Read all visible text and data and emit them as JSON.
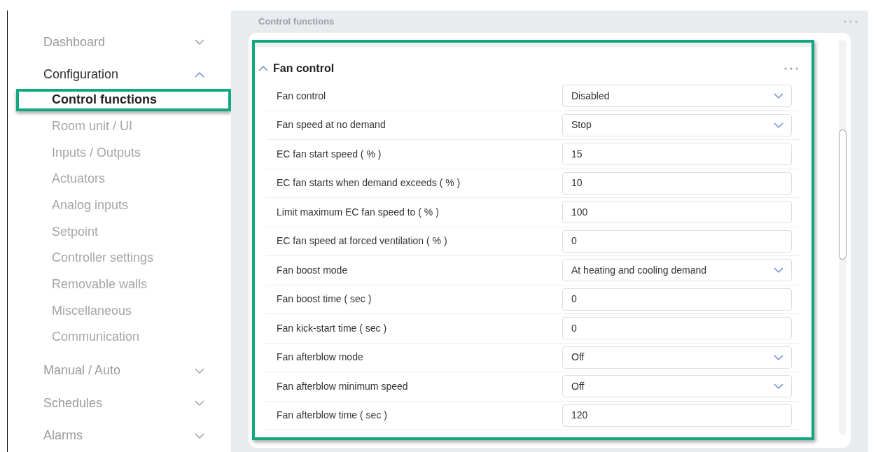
{
  "sidebar": {
    "items": [
      {
        "label": "Dashboard",
        "expanded": false
      },
      {
        "label": "Configuration",
        "expanded": true,
        "children": [
          {
            "label": "Control functions",
            "selected": true,
            "highlighted": true
          },
          {
            "label": "Room unit / UI",
            "selected": false,
            "highlighted": false
          },
          {
            "label": "Inputs / Outputs",
            "selected": false,
            "highlighted": false
          },
          {
            "label": "Actuators",
            "selected": false,
            "highlighted": false
          },
          {
            "label": "Analog inputs",
            "selected": false,
            "highlighted": false
          },
          {
            "label": "Setpoint",
            "selected": false,
            "highlighted": false
          },
          {
            "label": "Controller settings",
            "selected": false,
            "highlighted": false
          },
          {
            "label": "Removable walls",
            "selected": false,
            "highlighted": false
          },
          {
            "label": "Miscellaneous",
            "selected": false,
            "highlighted": false
          },
          {
            "label": "Communication",
            "selected": false,
            "highlighted": false
          }
        ]
      },
      {
        "label": "Manual / Auto",
        "expanded": false
      },
      {
        "label": "Schedules",
        "expanded": false
      },
      {
        "label": "Alarms",
        "expanded": false
      }
    ]
  },
  "page_title": "Control functions",
  "section": {
    "title": "Fan control",
    "expanded": true,
    "highlighted": true,
    "rows": [
      {
        "label": "Fan control",
        "kind": "select",
        "value": "Disabled"
      },
      {
        "label": "Fan speed at no demand",
        "kind": "select",
        "value": "Stop"
      },
      {
        "label": "EC fan start speed ( % )",
        "kind": "number",
        "value": "15"
      },
      {
        "label": "EC fan starts when demand exceeds ( % )",
        "kind": "number",
        "value": "10"
      },
      {
        "label": "Limit maximum EC fan speed to ( % )",
        "kind": "number",
        "value": "100"
      },
      {
        "label": "EC fan speed at forced ventilation ( % )",
        "kind": "number",
        "value": "0"
      },
      {
        "label": "Fan boost mode",
        "kind": "select",
        "value": "At heating and cooling demand"
      },
      {
        "label": "Fan boost time ( sec )",
        "kind": "number",
        "value": "0"
      },
      {
        "label": "Fan kick-start time ( sec )",
        "kind": "number",
        "value": "0"
      },
      {
        "label": "Fan afterblow mode",
        "kind": "select",
        "value": "Off"
      },
      {
        "label": "Fan afterblow minimum speed",
        "kind": "select",
        "value": "Off"
      },
      {
        "label": "Fan afterblow time ( sec )",
        "kind": "number",
        "value": "120"
      }
    ]
  }
}
